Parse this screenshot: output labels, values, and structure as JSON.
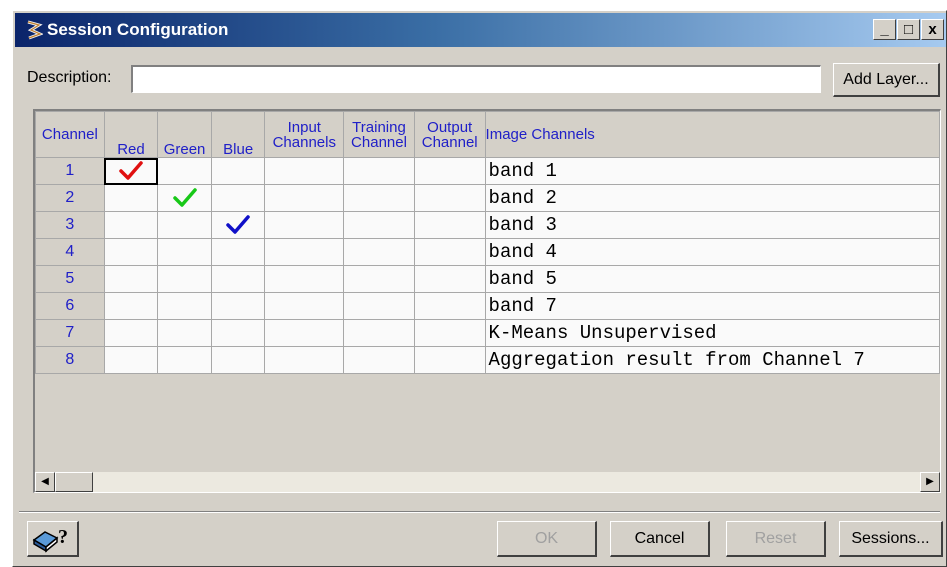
{
  "window": {
    "title": "Session Configuration",
    "controls": {
      "minimize": "_",
      "maximize": "□",
      "close": "x"
    }
  },
  "description": {
    "label": "Description:",
    "value": ""
  },
  "buttons": {
    "add_layer": "Add Layer...",
    "ok": "OK",
    "cancel": "Cancel",
    "reset": "Reset",
    "sessions": "Sessions..."
  },
  "grid": {
    "headers": {
      "channel": "Channel",
      "red": "Red",
      "green": "Green",
      "blue": "Blue",
      "input_line1": "Input",
      "input_line2": "Channels",
      "training_line1": "Training",
      "training_line2": "Channel",
      "output_line1": "Output",
      "output_line2": "Channel",
      "image_channels": "Image Channels"
    },
    "rows": [
      {
        "channel": "1",
        "red": true,
        "green": false,
        "blue": false,
        "image": "band 1"
      },
      {
        "channel": "2",
        "red": false,
        "green": true,
        "blue": false,
        "image": "band 2"
      },
      {
        "channel": "3",
        "red": false,
        "green": false,
        "blue": true,
        "image": "band 3"
      },
      {
        "channel": "4",
        "red": false,
        "green": false,
        "blue": false,
        "image": "band 4"
      },
      {
        "channel": "5",
        "red": false,
        "green": false,
        "blue": false,
        "image": "band 5"
      },
      {
        "channel": "6",
        "red": false,
        "green": false,
        "blue": false,
        "image": "band 7"
      },
      {
        "channel": "7",
        "red": false,
        "green": false,
        "blue": false,
        "image": "K-Means Unsupervised"
      },
      {
        "channel": "8",
        "red": false,
        "green": false,
        "blue": false,
        "image": "Aggregation result from Channel 7"
      }
    ]
  },
  "help_button": {
    "label": "?",
    "icon": "book-help-icon"
  },
  "colors": {
    "red_check": "#e01010",
    "green_check": "#18c818",
    "blue_check": "#1010c8",
    "header_text": "#2020c8",
    "face": "#d4d0c8"
  }
}
